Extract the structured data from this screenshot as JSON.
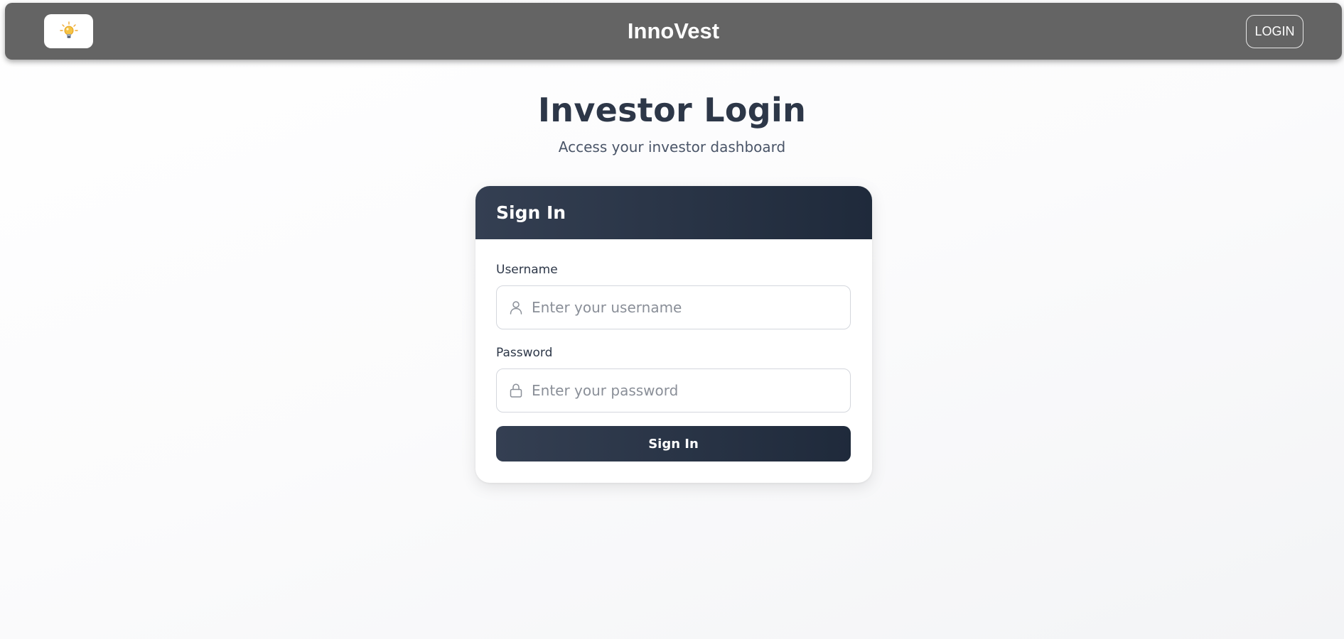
{
  "navbar": {
    "logo_icon": "lightbulb-icon",
    "brand": "InnoVest",
    "login_button": "LOGIN"
  },
  "page": {
    "title": "Investor Login",
    "subtitle": "Access your investor dashboard"
  },
  "card": {
    "header_title": "Sign In",
    "username": {
      "label": "Username",
      "placeholder": "Enter your username",
      "value": "",
      "icon": "user-icon"
    },
    "password": {
      "label": "Password",
      "placeholder": "Enter your password",
      "value": "",
      "icon": "lock-icon"
    },
    "submit_label": "Sign In"
  },
  "colors": {
    "navbar_bg": "#646464",
    "card_header_bg": "#2d3748",
    "title_text": "#2d3748",
    "bulb_yellow": "#f6c343"
  }
}
